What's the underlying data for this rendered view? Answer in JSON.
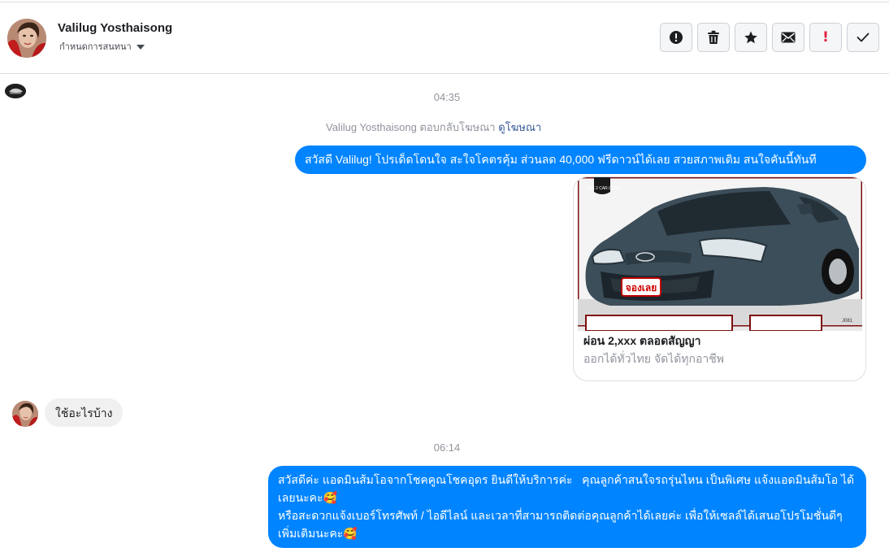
{
  "header": {
    "contact_name": "Valilug Yosthaisong",
    "assign_label": "กำหนดการสนทนา",
    "toolbar": {
      "spam_icon": "exclamation-circle-icon",
      "delete_icon": "trash-icon",
      "star_icon": "star-icon",
      "unread_icon": "envelope-icon",
      "priority_label": "!",
      "done_icon": "checkmark-icon"
    }
  },
  "thread": {
    "time_1": "04:35",
    "ad_reply": {
      "sender": "Valilug Yosthaisong",
      "action": "ตอบกลับโฆษณา",
      "link": "ดูโฆษณา"
    },
    "msg_out_1": "สวัสดี Valilug! โปรเด็ดโดนใจ สะใจโคตรคุ้ม ส่วนลด 40,000 ฟรีดาวน์ได้เลย สวยสภาพเดิม สนใจคันนี้ทันที",
    "ad_card": {
      "title": "ผ่อน 2,xxx ตลอดสัญญา",
      "subtitle": "ออกได้ทั่วไทย จัดได้ทุกอาชีพ",
      "image": {
        "brand_text": "CKC 2 CAR.COM",
        "badge_text": "จองเลย",
        "code_text": "J081"
      }
    },
    "msg_in_1": "ใช้อะไรบ้าง",
    "time_2": "06:14",
    "msg_out_2": "สวัสดีค่ะ แอดมินส้มโอจากโชคคูณโชคอุดร ยินดีให้บริการค่ะ   คุณลูกค้าสนใจรถรุ่นไหน เป็นพิเศษ แจ้งแอดมินส้มโอ ได้เลยนะคะ🥰\nหรือสะดวกแจ้งเบอร์โทรศัพท์ / ไอดีไลน์ และเวลาที่สามารถติดต่อคุณลูกค้าได้เลยค่ะ เพื่อให้เซลล์ได้เสนอโปรโมชั่นดีๆเพิ่มเติมนะคะ🥰"
  },
  "colors": {
    "bubble_out": "#0084ff",
    "bubble_in": "#f1f0f0",
    "link": "#385898",
    "timestamp": "#90949c",
    "priority": "#e41e3f"
  }
}
